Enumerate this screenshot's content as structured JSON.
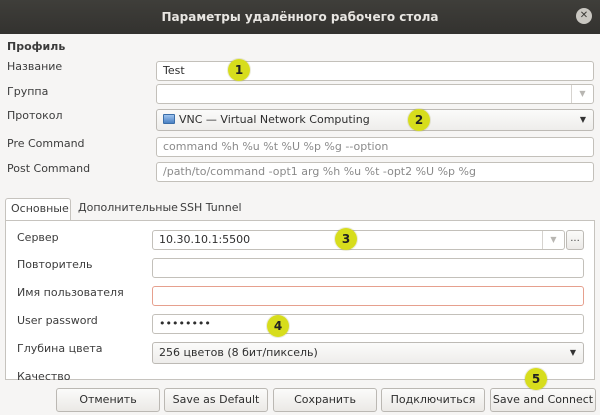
{
  "window": {
    "title": "Параметры удалённого рабочего стола",
    "close_glyph": "✕"
  },
  "profile": {
    "section_label": "Профиль",
    "name_label": "Название",
    "name_value": "Test",
    "group_label": "Группа",
    "group_value": "",
    "protocol_label": "Протокол",
    "protocol_value": "VNC — Virtual Network Computing",
    "protocol_icon": "vnc-monitor-icon",
    "precommand_label": "Pre Command",
    "precommand_placeholder": "command %h %u %t %U %p %g --option",
    "postcommand_label": "Post Command",
    "postcommand_placeholder": "/path/to/command -opt1 arg %h %u %t -opt2 %U %p %g"
  },
  "tabs": [
    {
      "label": "Основные",
      "active": true
    },
    {
      "label": "Дополнительные",
      "active": false
    },
    {
      "label": "SSH Tunnel",
      "active": false
    }
  ],
  "basic": {
    "server_label": "Сервер",
    "server_value": "10.30.10.1:5500",
    "browse_label": "...",
    "repeater_label": "Повторитель",
    "repeater_value": "",
    "username_label": "Имя пользователя",
    "username_value": "",
    "password_label": "User password",
    "password_value": "••••••••",
    "color_depth_label": "Глубина цвета",
    "color_depth_value": "256 цветов (8 бит/пиксель)",
    "quality_label": "Качество"
  },
  "buttons": {
    "cancel": "Отменить",
    "save_default": "Save as Default",
    "save": "Сохранить",
    "connect": "Подключиться",
    "save_connect": "Save and Connect"
  },
  "annotations": [
    "1",
    "2",
    "3",
    "4",
    "5"
  ],
  "colors": {
    "badge": "#d7dd1c",
    "titlebar": "#3a3935",
    "error_border": "#e6a08e"
  }
}
